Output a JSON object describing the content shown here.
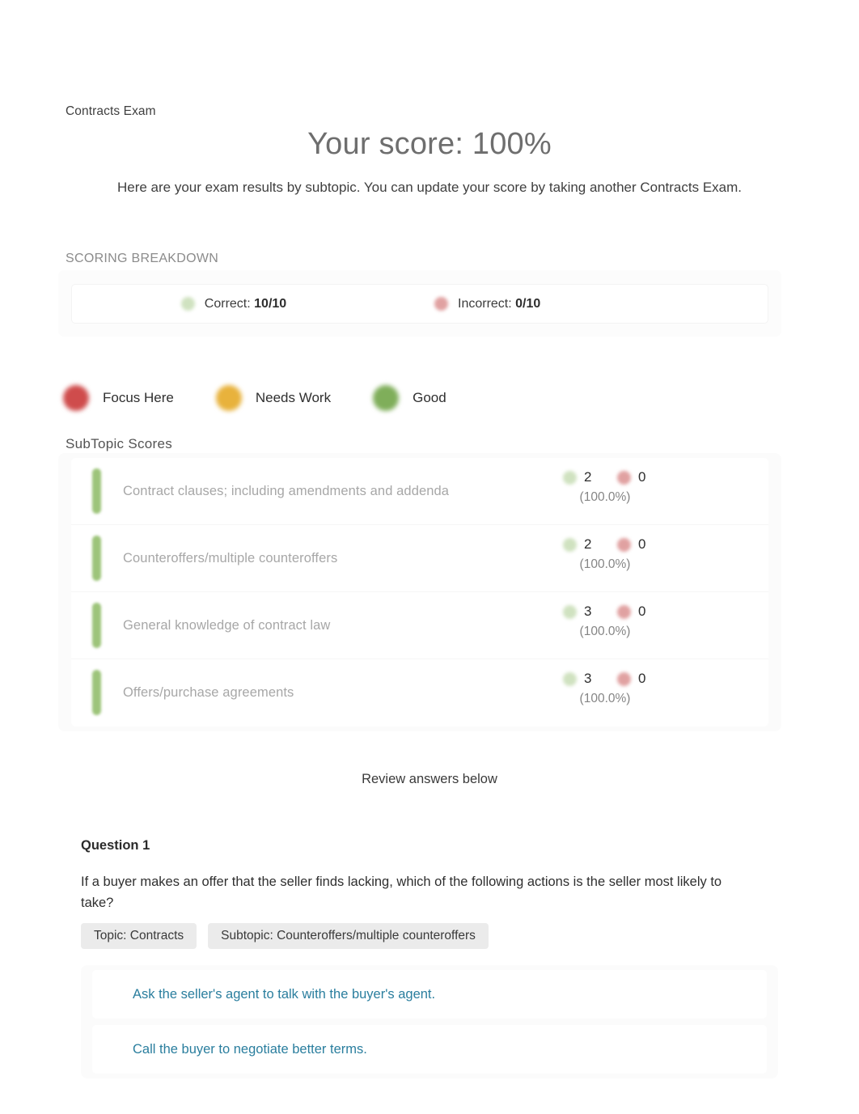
{
  "breadcrumb": "Contracts Exam",
  "hero": {
    "score_title": "Your score: 100%",
    "subtitle": "Here are your exam results by subtopic. You can update your score by taking another Contracts Exam."
  },
  "scoring_breakdown": {
    "label": "SCORING BREAKDOWN",
    "correct": {
      "icon": "check-circle-icon",
      "label": "Correct:",
      "value": "10/10",
      "color": "#7fae5a"
    },
    "incorrect": {
      "icon": "x-circle-icon",
      "label": "Incorrect:",
      "value": "0/10",
      "color": "#cf4c4c"
    }
  },
  "legend": {
    "items": [
      {
        "label": "Focus Here",
        "color": "#cf4c4c",
        "icon": "status-dot-red"
      },
      {
        "label": "Needs Work",
        "color": "#e8b23c",
        "icon": "status-dot-amber"
      },
      {
        "label": "Good",
        "color": "#7fae5a",
        "icon": "status-dot-green"
      }
    ]
  },
  "subtopics": {
    "label": "SubTopic Scores",
    "rows": [
      {
        "name": "Contract clauses; including amendments and addenda",
        "correct": "2",
        "incorrect": "0",
        "percent": "(100.0%)",
        "status": "good",
        "bar_color": "#8cba63"
      },
      {
        "name": "Counteroffers/multiple counteroffers",
        "correct": "2",
        "incorrect": "0",
        "percent": "(100.0%)",
        "status": "good",
        "bar_color": "#8cba63"
      },
      {
        "name": "General knowledge of contract law",
        "correct": "3",
        "incorrect": "0",
        "percent": "(100.0%)",
        "status": "good",
        "bar_color": "#8cba63"
      },
      {
        "name": "Offers/purchase agreements",
        "correct": "3",
        "incorrect": "0",
        "percent": "(100.0%)",
        "status": "good",
        "bar_color": "#8cba63"
      }
    ]
  },
  "review_note": "Review answers below",
  "question": {
    "heading": "Question 1",
    "text": "If a buyer makes an offer that the seller finds lacking, which of the following actions is the seller most likely to take?",
    "topic_tag": "Topic: Contracts",
    "subtopic_tag": "Subtopic: Counteroffers/multiple counteroffers",
    "answers": [
      "Ask the seller's agent to talk with the buyer's agent.",
      "Call the buyer to negotiate better terms."
    ],
    "answer_color": "#2a7e9e"
  }
}
